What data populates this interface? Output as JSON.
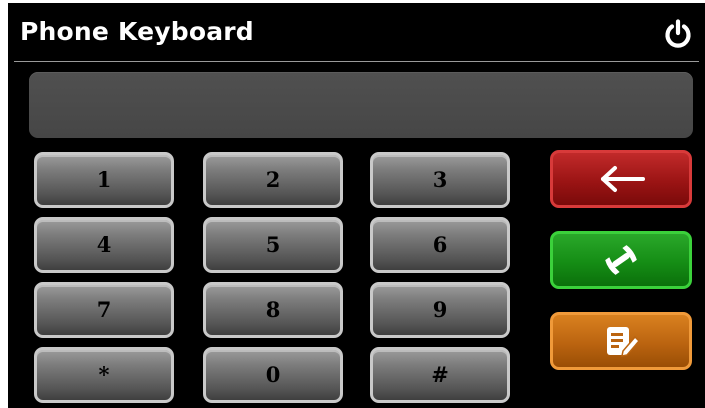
{
  "window": {
    "title": "Phone Keyboard"
  },
  "display": {
    "value": ""
  },
  "keypad": {
    "keys": [
      "1",
      "2",
      "3",
      "4",
      "5",
      "6",
      "7",
      "8",
      "9",
      "*",
      "0",
      "#"
    ]
  },
  "actions": {
    "backspace_icon": "arrow-left-icon",
    "call_icon": "phone-handset-icon",
    "contacts_icon": "contact-book-edit-icon"
  },
  "colors": {
    "background": "#000000",
    "key_gray": "#6e6e6e",
    "backspace_red": "#9b1414",
    "call_green": "#158d15",
    "contacts_orange": "#bb6410"
  }
}
